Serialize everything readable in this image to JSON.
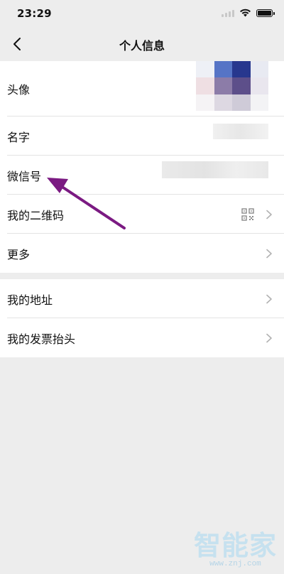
{
  "status_bar": {
    "time": "23:29",
    "icons": [
      "signal-icon",
      "wifi-icon",
      "battery-icon"
    ]
  },
  "nav": {
    "back_icon": "chevron-left-icon",
    "title": "个人信息"
  },
  "profile_section": {
    "items": [
      {
        "label": "头像",
        "value": "[blurred avatar image]",
        "icon": "none"
      },
      {
        "label": "名字",
        "value": "[blurred name]",
        "icon": "none"
      },
      {
        "label": "微信号",
        "value": "[blurred wechat id]",
        "icon": "none"
      },
      {
        "label": "我的二维码",
        "icon": "qr-code-icon",
        "chevron": "chevron-right-icon"
      },
      {
        "label": "更多",
        "chevron": "chevron-right-icon"
      }
    ]
  },
  "address_section": {
    "items": [
      {
        "label": "我的地址",
        "chevron": "chevron-right-icon"
      },
      {
        "label": "我的发票抬头",
        "chevron": "chevron-right-icon"
      }
    ]
  },
  "annotation": {
    "type": "arrow",
    "color": "#7b1a82",
    "points_to": "微信号"
  },
  "watermark": {
    "logo": "智能家",
    "url": "www.znj.com"
  },
  "colors": {
    "page_background": "#ededed",
    "list_background": "#ffffff",
    "divider": "#e3e3e3",
    "chevron": "#b2b2b2",
    "annotation_arrow": "#7b1a82"
  }
}
